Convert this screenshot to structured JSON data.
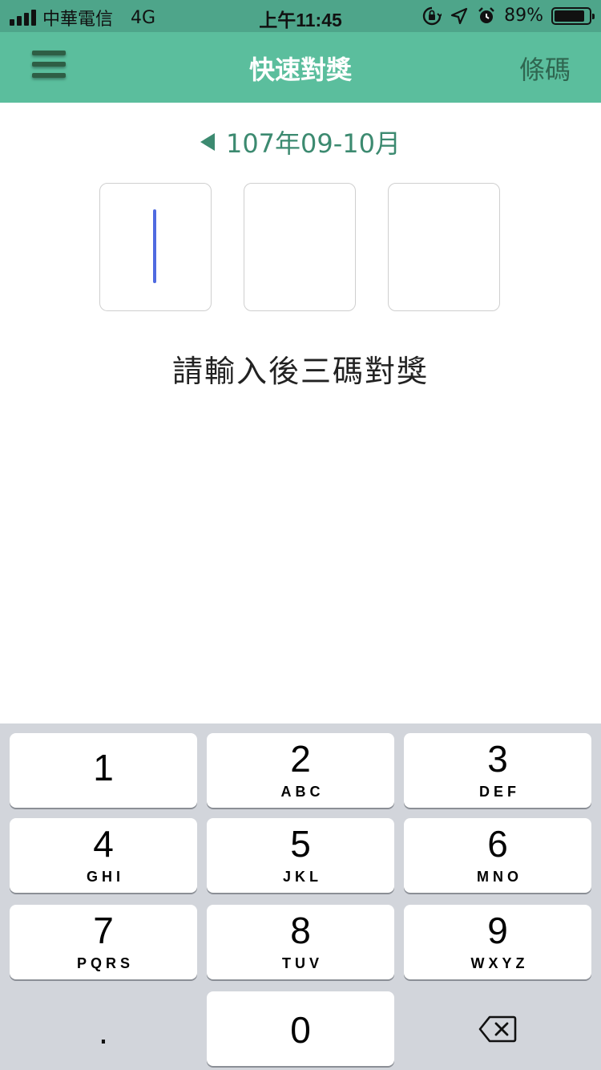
{
  "status_bar": {
    "carrier": "中華電信",
    "network": "4G",
    "time": "上午11:45",
    "battery_percent": "89%",
    "battery_level": 0.89,
    "icons": [
      "orientation-lock-icon",
      "location-arrow-icon",
      "alarm-icon"
    ]
  },
  "nav": {
    "title": "快速對獎",
    "right_action": "條碼",
    "menu_icon": "hamburger-menu-icon"
  },
  "period": {
    "label": "107年09-10月",
    "prev_icon": "triangle-left-icon"
  },
  "digits": [
    "",
    "",
    ""
  ],
  "prompt": "請輸入後三碼對獎",
  "keypad": {
    "keys": [
      {
        "digit": "1",
        "letters": ""
      },
      {
        "digit": "2",
        "letters": "ABC"
      },
      {
        "digit": "3",
        "letters": "DEF"
      },
      {
        "digit": "4",
        "letters": "GHI"
      },
      {
        "digit": "5",
        "letters": "JKL"
      },
      {
        "digit": "6",
        "letters": "MNO"
      },
      {
        "digit": "7",
        "letters": "PQRS"
      },
      {
        "digit": "8",
        "letters": "TUV"
      },
      {
        "digit": "9",
        "letters": "WXYZ"
      }
    ],
    "dot": ".",
    "zero": "0",
    "delete_icon": "backspace-icon"
  },
  "colors": {
    "status_bar_bg": "#4ea58a",
    "nav_bg": "#5bbe9d",
    "accent_text": "#3c8a70",
    "caret": "#4f6ae0",
    "keypad_bg": "#d2d5db"
  }
}
